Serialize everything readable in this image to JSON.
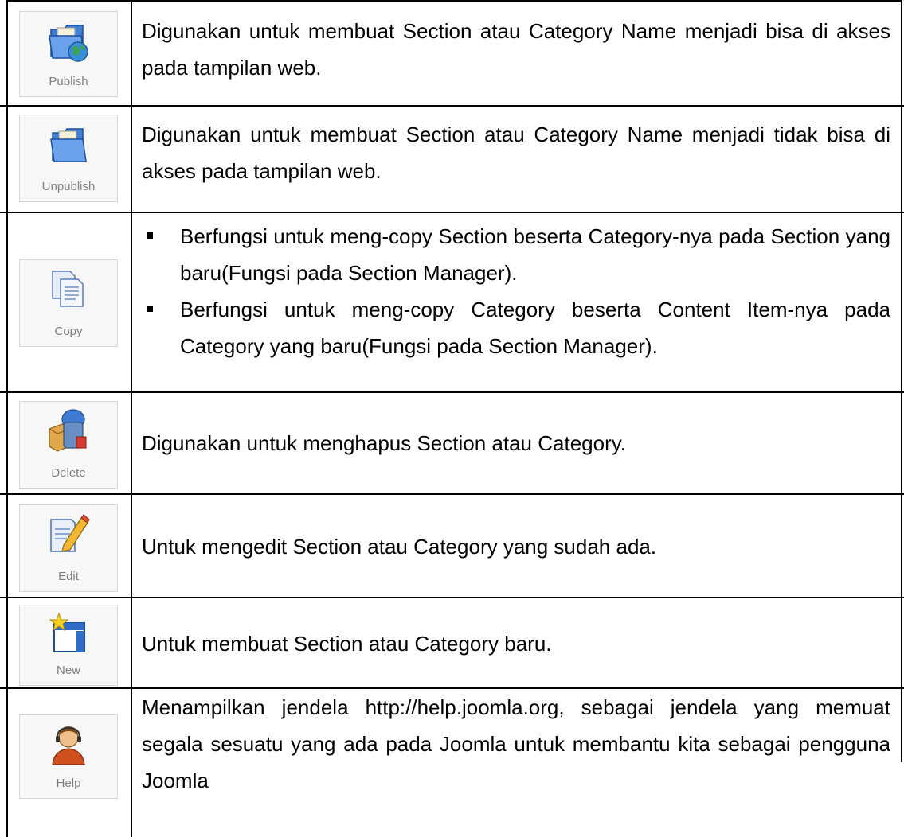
{
  "rows": [
    {
      "icon": "publish-folder-globe-icon",
      "label": "Publish",
      "text": "Digunakan untuk membuat Section atau Category Name menjadi bisa di akses pada tampilan web."
    },
    {
      "icon": "unpublish-folder-icon",
      "label": "Unpublish",
      "text": "Digunakan untuk membuat Section atau Category Name menjadi tidak bisa di akses pada tampilan web."
    },
    {
      "icon": "copy-documents-icon",
      "label": "Copy",
      "bullets": [
        "Berfungsi untuk meng-copy Section beserta Category-nya pada Section yang baru(Fungsi pada Section Manager).",
        "Berfungsi untuk meng-copy Category beserta Content Item-nya pada Category yang baru(Fungsi pada Section Manager)."
      ]
    },
    {
      "icon": "delete-trash-icon",
      "label": "Delete",
      "text": "Digunakan untuk menghapus Section atau Category."
    },
    {
      "icon": "edit-pencil-icon",
      "label": "Edit",
      "text": "Untuk mengedit  Section atau Category yang sudah ada."
    },
    {
      "icon": "new-window-star-icon",
      "label": "New",
      "text": "Untuk membuat Section atau Category baru."
    },
    {
      "icon": "help-support-person-icon",
      "label": "Help",
      "text": "Menampilkan jendela http://help.joomla.org, sebagai jendela yang memuat segala sesuatu yang ada pada Joomla untuk membantu kita sebagai pengguna Joomla"
    }
  ],
  "colors": {
    "border": "#000000",
    "button_bg": "#f7f7f7",
    "button_label": "#808080",
    "folder_blue": "#3f7fd6",
    "globe_green": "#3aa54a"
  }
}
